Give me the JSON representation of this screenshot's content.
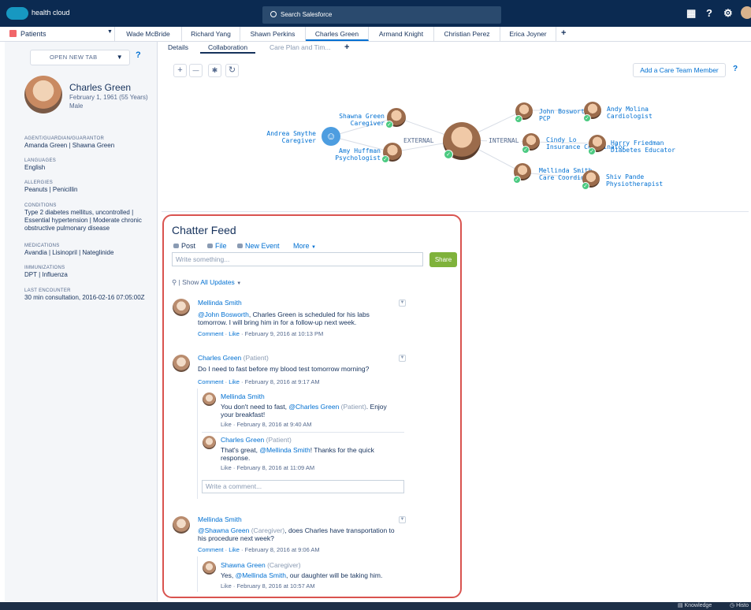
{
  "header": {
    "brand": "health cloud",
    "search_placeholder": "Search Salesforce",
    "icons": [
      "apps-grid-icon",
      "help-icon",
      "settings-gear-icon",
      "user-avatar"
    ]
  },
  "tabs": {
    "app_label": "Patients",
    "items": [
      {
        "label": "Wade McBride"
      },
      {
        "label": "Richard Yang"
      },
      {
        "label": "Shawn Perkins"
      },
      {
        "label": "Charles Green"
      },
      {
        "label": "Armand Knight"
      },
      {
        "label": "Christian Perez"
      },
      {
        "label": "Erica Joyner"
      }
    ],
    "add": "+"
  },
  "patient": {
    "open_new_tab": "OPEN NEW TAB",
    "help": "?",
    "name": "Charles Green",
    "dob": "February 1, 1961 (55 Years)",
    "sex": "Male",
    "fields": [
      {
        "label": "AGENT/GUARDIAN/GUARANTOR",
        "value": "Amanda Green | Shawna Green"
      },
      {
        "label": "LANGUAGES",
        "value": "English"
      },
      {
        "label": "ALLERGIES",
        "value": "Peanuts | Penicillin"
      },
      {
        "label": "CONDITIONS",
        "value": "Type 2 diabetes mellitus, uncontrolled | Essential hypertension | Moderate chronic obstructive pulmonary disease"
      },
      {
        "label": "MEDICATIONS",
        "value": "Avandia | Lisinopril | Nateglinide"
      },
      {
        "label": "IMMUNIZATIONS",
        "value": "DPT | Influenza"
      },
      {
        "label": "LAST ENCOUNTER",
        "value": "30 min consultation, 2016-02-16 07:05:00Z"
      }
    ]
  },
  "subtabs": {
    "details": "Details",
    "collaboration": "Collaboration",
    "careplan": "Care Plan and Tim...",
    "add": "+"
  },
  "toolbar": {
    "zoom_in": "+",
    "zoom_out": "—",
    "center": "✱",
    "refresh": "↻",
    "add_care": "Add a Care Team Member",
    "help": "?"
  },
  "network": {
    "external": "EXTERNAL",
    "internal": "INTERNAL",
    "members": [
      {
        "name": "Andrea Smythe",
        "role": "Caregiver"
      },
      {
        "name": "Shawna Green",
        "role": "Caregiver"
      },
      {
        "name": "Amy Huffman",
        "role": "Psychologist"
      },
      {
        "name": "John Bosworth",
        "role": "PCP"
      },
      {
        "name": "Cindy Lo",
        "role": "Insurance Coordinator"
      },
      {
        "name": "Mellinda Smith",
        "role": "Care Coordinator"
      },
      {
        "name": "Andy Molina",
        "role": "Cardiologist"
      },
      {
        "name": "Harry Friedman",
        "role": "Diabetes Educator"
      },
      {
        "name": "Shiv Pande",
        "role": "Physiotherapist"
      }
    ]
  },
  "chatter": {
    "title": "Chatter Feed",
    "actions": {
      "post": "Post",
      "file": "File",
      "event": "New Event",
      "more": "More"
    },
    "input_placeholder": "Write something...",
    "share": "Share",
    "show": "Show",
    "filter": "All Updates",
    "comment_placeholder": "Write a comment...",
    "posts": [
      {
        "author": "Mellinda Smith",
        "mention": "@John Bosworth",
        "text": ", Charles Green is scheduled for his labs tomorrow. I will bring him in for a follow-up next week.",
        "comment": "Comment",
        "like": "Like",
        "time": "February 9, 2016 at 10:13 PM"
      },
      {
        "author": "Charles Green",
        "role": "(Patient)",
        "text": "Do I need to fast before my blood test tomorrow morning?",
        "comment": "Comment",
        "like": "Like",
        "time": "February 8, 2016 at 9:17 AM",
        "replies": [
          {
            "author": "Mellinda Smith",
            "text_a": "You don't need to fast, ",
            "mention": "@Charles Green",
            "role": "(Patient)",
            "text_b": ". Enjoy your breakfast!",
            "like": "Like",
            "time": "February 8, 2016 at 9:40 AM"
          },
          {
            "author": "Charles Green",
            "role": "(Patient)",
            "text_a": "That's great, ",
            "mention": "@Mellinda Smith",
            "text_b": "! Thanks for the quick response.",
            "like": "Like",
            "time": "February 8, 2016 at 11:09 AM"
          }
        ]
      },
      {
        "author": "Mellinda Smith",
        "mention": "@Shawna Green",
        "role": "(Caregiver)",
        "text": ", does Charles have transportation to his procedure next week?",
        "comment": "Comment",
        "like": "Like",
        "time": "February 8, 2016 at 9:06 AM",
        "replies": [
          {
            "author": "Shawna Green",
            "role": "(Caregiver)",
            "text_a": "Yes, ",
            "mention": "@Mellinda Smith",
            "text_b": ", our daughter will be taking him.",
            "like": "Like",
            "time": "February 8, 2016 at 10:57 AM"
          }
        ]
      }
    ]
  },
  "footer": {
    "knowledge": "Knowledge",
    "history": "Histo"
  },
  "colors": {
    "header": "#0b2a51",
    "link": "#0070d2",
    "share": "#7fb23b",
    "highlight": "#d9534f",
    "check": "#4bca81"
  }
}
